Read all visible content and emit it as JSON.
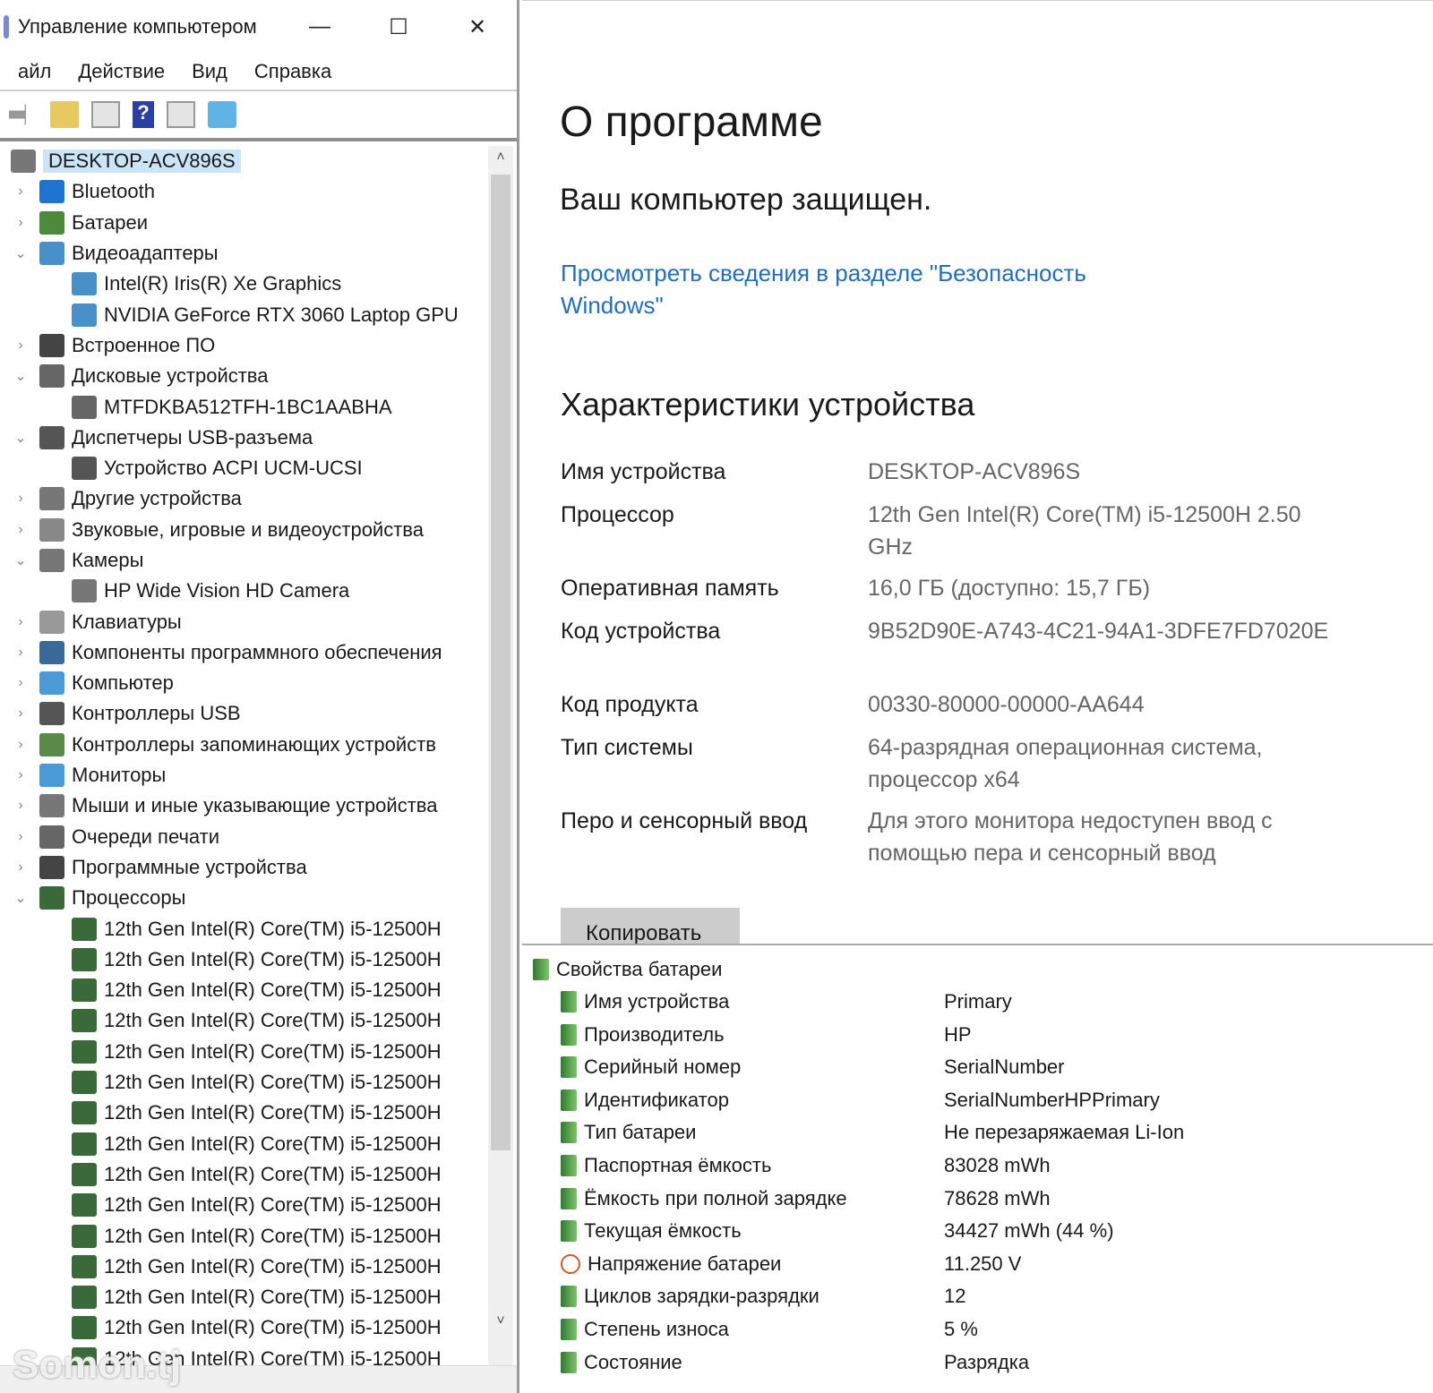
{
  "window": {
    "title": "Управление компьютером",
    "minimize": "—",
    "maximize": "☐",
    "close": "✕"
  },
  "menu": [
    "айл",
    "Действие",
    "Вид",
    "Справка"
  ],
  "toolbar": [
    "back-icon",
    "forward-icon",
    "folder-up-icon",
    "show-hide-tree-icon",
    "help-icon",
    "show-hide-action-icon",
    "monitor-icon"
  ],
  "tree": {
    "root": "DESKTOP-ACV896S",
    "items": [
      {
        "label": "Bluetooth",
        "level": 1,
        "expanded": false,
        "icon": "bluetooth-icon",
        "color": "#1e74d0"
      },
      {
        "label": "Батареи",
        "level": 1,
        "expanded": false,
        "icon": "battery-icon",
        "color": "#4a8a3a"
      },
      {
        "label": "Видеоадаптеры",
        "level": 1,
        "expanded": true,
        "icon": "display-adapter-icon",
        "color": "#4a90c8"
      },
      {
        "label": "Intel(R) Iris(R) Xe Graphics",
        "level": 2,
        "icon": "display-adapter-icon",
        "color": "#4a90c8"
      },
      {
        "label": "NVIDIA GeForce RTX 3060 Laptop GPU",
        "level": 2,
        "icon": "display-adapter-icon",
        "color": "#4a90c8"
      },
      {
        "label": "Встроенное ПО",
        "level": 1,
        "expanded": false,
        "icon": "firmware-icon",
        "color": "#444"
      },
      {
        "label": "Дисковые устройства",
        "level": 1,
        "expanded": true,
        "icon": "disk-icon",
        "color": "#666"
      },
      {
        "label": "MTFDKBA512TFH-1BC1AABHA",
        "level": 2,
        "icon": "disk-icon",
        "color": "#666"
      },
      {
        "label": "Диспетчеры USB-разъема",
        "level": 1,
        "expanded": true,
        "icon": "usb-icon",
        "color": "#555"
      },
      {
        "label": "Устройство ACPI UCM-UCSI",
        "level": 2,
        "icon": "usb-icon",
        "color": "#555"
      },
      {
        "label": "Другие устройства",
        "level": 1,
        "expanded": false,
        "icon": "other-devices-icon",
        "color": "#777"
      },
      {
        "label": "Звуковые, игровые и видеоустройства",
        "level": 1,
        "expanded": false,
        "icon": "speaker-icon",
        "color": "#888"
      },
      {
        "label": "Камеры",
        "level": 1,
        "expanded": true,
        "icon": "camera-icon",
        "color": "#777"
      },
      {
        "label": "HP Wide Vision HD Camera",
        "level": 2,
        "icon": "camera-icon",
        "color": "#777"
      },
      {
        "label": "Клавиатуры",
        "level": 1,
        "expanded": false,
        "icon": "keyboard-icon",
        "color": "#999"
      },
      {
        "label": "Компоненты программного обеспечения",
        "level": 1,
        "expanded": false,
        "icon": "software-component-icon",
        "color": "#3a6a9a"
      },
      {
        "label": "Компьютер",
        "level": 1,
        "expanded": false,
        "icon": "computer-icon",
        "color": "#4a9ad8"
      },
      {
        "label": "Контроллеры USB",
        "level": 1,
        "expanded": false,
        "icon": "usb-icon",
        "color": "#555"
      },
      {
        "label": "Контроллеры запоминающих устройств",
        "level": 1,
        "expanded": false,
        "icon": "storage-controller-icon",
        "color": "#5a8a4a"
      },
      {
        "label": "Мониторы",
        "level": 1,
        "expanded": false,
        "icon": "monitor-icon",
        "color": "#4a9ad8"
      },
      {
        "label": "Мыши и иные указывающие устройства",
        "level": 1,
        "expanded": false,
        "icon": "mouse-icon",
        "color": "#777"
      },
      {
        "label": "Очереди печати",
        "level": 1,
        "expanded": false,
        "icon": "printer-icon",
        "color": "#666"
      },
      {
        "label": "Программные устройства",
        "level": 1,
        "expanded": false,
        "icon": "software-device-icon",
        "color": "#444"
      },
      {
        "label": "Процессоры",
        "level": 1,
        "expanded": true,
        "icon": "processor-icon",
        "color": "#3a6a3a"
      },
      {
        "label": "12th Gen Intel(R) Core(TM) i5-12500H",
        "level": 2,
        "icon": "processor-icon",
        "color": "#3a6a3a"
      },
      {
        "label": "12th Gen Intel(R) Core(TM) i5-12500H",
        "level": 2,
        "icon": "processor-icon",
        "color": "#3a6a3a"
      },
      {
        "label": "12th Gen Intel(R) Core(TM) i5-12500H",
        "level": 2,
        "icon": "processor-icon",
        "color": "#3a6a3a"
      },
      {
        "label": "12th Gen Intel(R) Core(TM) i5-12500H",
        "level": 2,
        "icon": "processor-icon",
        "color": "#3a6a3a"
      },
      {
        "label": "12th Gen Intel(R) Core(TM) i5-12500H",
        "level": 2,
        "icon": "processor-icon",
        "color": "#3a6a3a"
      },
      {
        "label": "12th Gen Intel(R) Core(TM) i5-12500H",
        "level": 2,
        "icon": "processor-icon",
        "color": "#3a6a3a"
      },
      {
        "label": "12th Gen Intel(R) Core(TM) i5-12500H",
        "level": 2,
        "icon": "processor-icon",
        "color": "#3a6a3a"
      },
      {
        "label": "12th Gen Intel(R) Core(TM) i5-12500H",
        "level": 2,
        "icon": "processor-icon",
        "color": "#3a6a3a"
      },
      {
        "label": "12th Gen Intel(R) Core(TM) i5-12500H",
        "level": 2,
        "icon": "processor-icon",
        "color": "#3a6a3a"
      },
      {
        "label": "12th Gen Intel(R) Core(TM) i5-12500H",
        "level": 2,
        "icon": "processor-icon",
        "color": "#3a6a3a"
      },
      {
        "label": "12th Gen Intel(R) Core(TM) i5-12500H",
        "level": 2,
        "icon": "processor-icon",
        "color": "#3a6a3a"
      },
      {
        "label": "12th Gen Intel(R) Core(TM) i5-12500H",
        "level": 2,
        "icon": "processor-icon",
        "color": "#3a6a3a"
      },
      {
        "label": "12th Gen Intel(R) Core(TM) i5-12500H",
        "level": 2,
        "icon": "processor-icon",
        "color": "#3a6a3a"
      },
      {
        "label": "12th Gen Intel(R) Core(TM) i5-12500H",
        "level": 2,
        "icon": "processor-icon",
        "color": "#3a6a3a"
      },
      {
        "label": "12th Gen Intel(R) Core(TM) i5-12500H",
        "level": 2,
        "icon": "processor-icon",
        "color": "#3a6a3a"
      }
    ]
  },
  "watermark": "Somon.tj",
  "about": {
    "title": "О программе",
    "protected": "Ваш компьютер защищен.",
    "security_link": "Просмотреть сведения в разделе \"Безопасность Windows\"",
    "specs_title": "Характеристики устройства",
    "specs": [
      {
        "key": "Имя устройства",
        "value": "DESKTOP-ACV896S"
      },
      {
        "key": "Процессор",
        "value": "12th Gen Intel(R) Core(TM) i5-12500H   2.50 GHz"
      },
      {
        "key": "Оперативная память",
        "value": "16,0 ГБ (доступно: 15,7 ГБ)"
      },
      {
        "key": "Код устройства",
        "value": "9B52D90E-A743-4C21-94A1-3DFE7FD7020E"
      },
      {
        "key": "Код продукта",
        "value": "00330-80000-00000-AA644"
      },
      {
        "key": "Тип системы",
        "value": "64-разрядная операционная система, процессор x64"
      },
      {
        "key": "Перо и сенсорный ввод",
        "value": "Для этого монитора недоступен ввод с помощью пера и сенсорный ввод"
      }
    ],
    "copy_button": "Копировать"
  },
  "battery": {
    "title": "Свойства батареи",
    "props": [
      {
        "key": "Имя устройства",
        "value": "Primary"
      },
      {
        "key": "Производитель",
        "value": "HP"
      },
      {
        "key": "Серийный номер",
        "value": "SerialNumber"
      },
      {
        "key": "Идентификатор",
        "value": "SerialNumberHPPrimary"
      },
      {
        "key": "Тип батареи",
        "value": "Не перезаряжаемая Li-Ion"
      },
      {
        "key": "Паспортная ёмкость",
        "value": "83028 mWh"
      },
      {
        "key": "Ёмкость при полной зарядке",
        "value": "78628 mWh"
      },
      {
        "key": "Текущая ёмкость",
        "value": "34427 mWh  (44 %)"
      },
      {
        "key": "Напряжение батареи",
        "value": "11.250 V"
      },
      {
        "key": "Циклов зарядки-разрядки",
        "value": "12"
      },
      {
        "key": "Степень износа",
        "value": "5 %"
      },
      {
        "key": "Состояние",
        "value": "Разрядка"
      }
    ]
  }
}
